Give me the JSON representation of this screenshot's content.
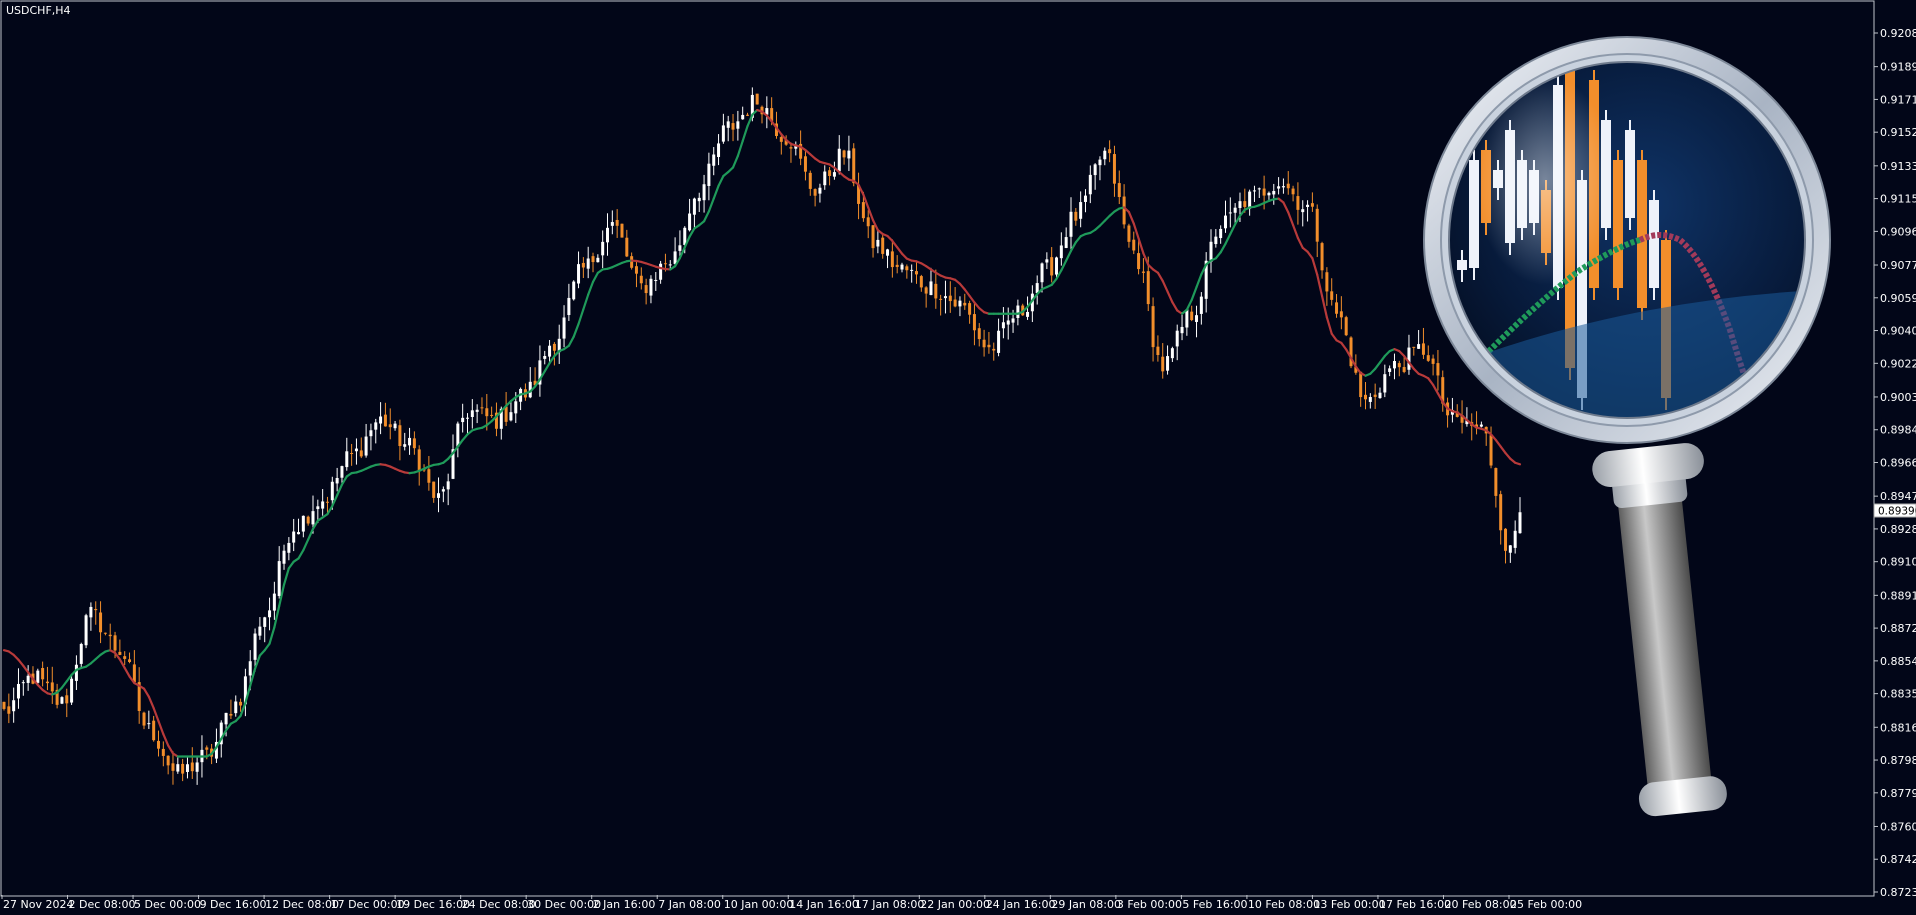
{
  "window": {
    "symbol_label": "USDCHF,H4"
  },
  "colors": {
    "background": "#020618",
    "border": "#c0c4cc",
    "bull_candle": "#ffffff",
    "bear_candle": "#f28e2b",
    "ma_up": "#1f9a5a",
    "ma_down": "#b83a3a",
    "price_label_bg": "#ffffff",
    "price_label_text": "#000000"
  },
  "current_price": "0.89390",
  "chart_data": {
    "type": "candlestick",
    "symbol": "USDCHF",
    "timeframe": "H4",
    "y_tick_labels": [
      "0.92085",
      "0.91895",
      "0.91710",
      "0.91525",
      "0.91335",
      "0.91150",
      "0.90965",
      "0.90775",
      "0.90590",
      "0.90405",
      "0.90220",
      "0.90030",
      "0.89845",
      "0.89660",
      "0.89470",
      "0.89285",
      "0.89100",
      "0.88910",
      "0.88725",
      "0.88540",
      "0.88355",
      "0.88165",
      "0.87980",
      "0.87795",
      "0.87605",
      "0.87420",
      "0.87235"
    ],
    "ylim": [
      0.8718,
      0.9222
    ],
    "x_tick_labels": [
      "27 Nov 2024",
      "2 Dec 08:00",
      "5 Dec 00:00",
      "9 Dec 16:00",
      "12 Dec 08:00",
      "17 Dec 00:00",
      "19 Dec 16:00",
      "24 Dec 08:00",
      "30 Dec 00:00",
      "2 Jan 16:00",
      "7 Jan 08:00",
      "10 Jan 00:00",
      "14 Jan 16:00",
      "17 Jan 08:00",
      "22 Jan 00:00",
      "24 Jan 16:00",
      "29 Jan 08:00",
      "3 Feb 00:00",
      "5 Feb 16:00",
      "10 Feb 08:00",
      "13 Feb 00:00",
      "17 Feb 16:00",
      "20 Feb 08:00",
      "25 Feb 00:00"
    ],
    "close_anchors": [
      [
        0,
        0.8825
      ],
      [
        6,
        0.8845
      ],
      [
        12,
        0.883
      ],
      [
        18,
        0.888
      ],
      [
        24,
        0.886
      ],
      [
        30,
        0.8815
      ],
      [
        36,
        0.879
      ],
      [
        42,
        0.88
      ],
      [
        48,
        0.883
      ],
      [
        54,
        0.888
      ],
      [
        60,
        0.893
      ],
      [
        66,
        0.8945
      ],
      [
        72,
        0.897
      ],
      [
        78,
        0.899
      ],
      [
        84,
        0.8975
      ],
      [
        90,
        0.8945
      ],
      [
        96,
        0.8995
      ],
      [
        102,
        0.899
      ],
      [
        108,
        0.9005
      ],
      [
        114,
        0.9035
      ],
      [
        120,
        0.9075
      ],
      [
        126,
        0.91
      ],
      [
        132,
        0.9065
      ],
      [
        138,
        0.908
      ],
      [
        144,
        0.912
      ],
      [
        150,
        0.9155
      ],
      [
        156,
        0.917
      ],
      [
        162,
        0.915
      ],
      [
        168,
        0.912
      ],
      [
        174,
        0.914
      ],
      [
        180,
        0.909
      ],
      [
        186,
        0.9075
      ],
      [
        192,
        0.9065
      ],
      [
        198,
        0.9055
      ],
      [
        204,
        0.903
      ],
      [
        210,
        0.905
      ],
      [
        216,
        0.9075
      ],
      [
        222,
        0.9105
      ],
      [
        228,
        0.914
      ],
      [
        234,
        0.9085
      ],
      [
        240,
        0.902
      ],
      [
        246,
        0.905
      ],
      [
        252,
        0.91
      ],
      [
        258,
        0.9115
      ],
      [
        264,
        0.9125
      ],
      [
        270,
        0.911
      ],
      [
        276,
        0.905
      ],
      [
        282,
        0.9
      ],
      [
        288,
        0.902
      ],
      [
        294,
        0.903
      ],
      [
        300,
        0.899
      ],
      [
        306,
        0.8985
      ],
      [
        312,
        0.8915
      ],
      [
        314,
        0.894
      ]
    ],
    "ma_anchors": [
      [
        0,
        0.886
      ],
      [
        10,
        0.8835
      ],
      [
        16,
        0.885
      ],
      [
        22,
        0.886
      ],
      [
        28,
        0.884
      ],
      [
        36,
        0.88
      ],
      [
        42,
        0.88
      ],
      [
        48,
        0.882
      ],
      [
        54,
        0.886
      ],
      [
        60,
        0.891
      ],
      [
        66,
        0.8935
      ],
      [
        72,
        0.896
      ],
      [
        78,
        0.8965
      ],
      [
        84,
        0.896
      ],
      [
        90,
        0.8965
      ],
      [
        98,
        0.8985
      ],
      [
        108,
        0.9005
      ],
      [
        116,
        0.903
      ],
      [
        124,
        0.9075
      ],
      [
        130,
        0.908
      ],
      [
        138,
        0.9075
      ],
      [
        144,
        0.91
      ],
      [
        150,
        0.913
      ],
      [
        156,
        0.9165
      ],
      [
        164,
        0.9145
      ],
      [
        170,
        0.9135
      ],
      [
        176,
        0.9125
      ],
      [
        182,
        0.9095
      ],
      [
        188,
        0.908
      ],
      [
        196,
        0.907
      ],
      [
        204,
        0.905
      ],
      [
        210,
        0.905
      ],
      [
        216,
        0.9065
      ],
      [
        224,
        0.9095
      ],
      [
        232,
        0.911
      ],
      [
        238,
        0.9075
      ],
      [
        244,
        0.905
      ],
      [
        250,
        0.908
      ],
      [
        258,
        0.911
      ],
      [
        264,
        0.9115
      ],
      [
        270,
        0.9085
      ],
      [
        276,
        0.9035
      ],
      [
        282,
        0.9015
      ],
      [
        288,
        0.903
      ],
      [
        294,
        0.9015
      ],
      [
        300,
        0.8995
      ],
      [
        306,
        0.8985
      ],
      [
        314,
        0.8965
      ]
    ]
  },
  "magnifier": {
    "icon_name": "magnifier-icon"
  }
}
